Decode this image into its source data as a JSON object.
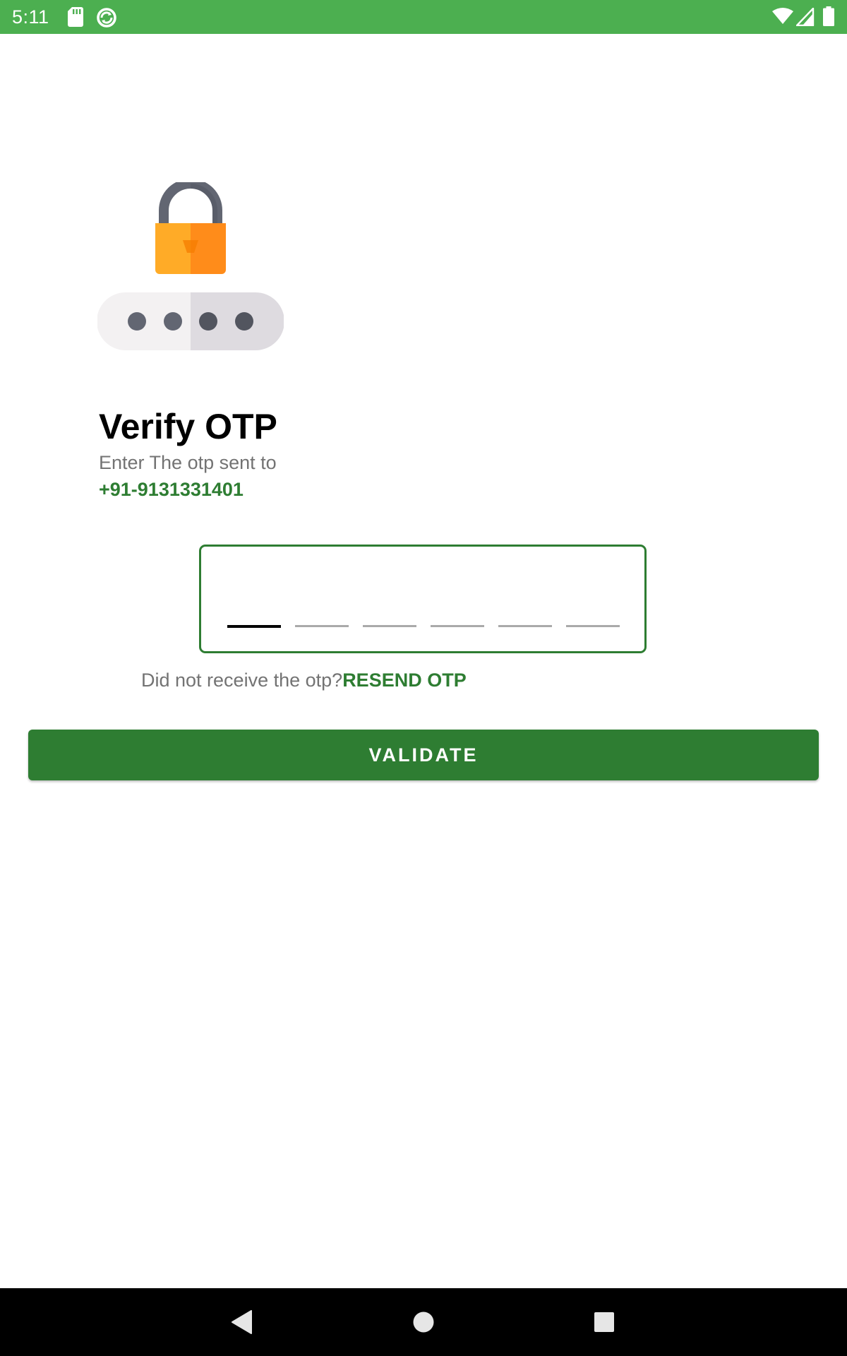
{
  "status_bar": {
    "time": "5:11",
    "background_color": "#4caf50",
    "left_icons": [
      "sd-card-icon",
      "sync-icon"
    ],
    "right_icons": [
      "wifi-icon",
      "cell-signal-icon",
      "battery-icon"
    ]
  },
  "illustration": {
    "icon": "lock-password-icon",
    "lock_body_colors": [
      "#ffab27",
      "#ff8c1a"
    ],
    "shackle_color": "#626672",
    "field_colors": [
      "#f3f1f2",
      "#dedbe0"
    ],
    "dot_color": "#626672",
    "dot_count": 4
  },
  "header": {
    "title": "Verify OTP",
    "subtitle": "Enter The otp sent to",
    "phone": "+91-9131331401"
  },
  "otp": {
    "slot_count": 6,
    "active_slot": 0,
    "values": [
      "",
      "",
      "",
      "",
      "",
      ""
    ],
    "border_color": "#2e7d32"
  },
  "resend": {
    "prompt": "Did not receive the otp?",
    "link_label": "RESEND OTP"
  },
  "validate_button": {
    "label": "VALIDATE",
    "color": "#2e7d32"
  },
  "nav_bar": {
    "buttons": [
      "back-icon",
      "home-icon",
      "recents-icon"
    ]
  }
}
